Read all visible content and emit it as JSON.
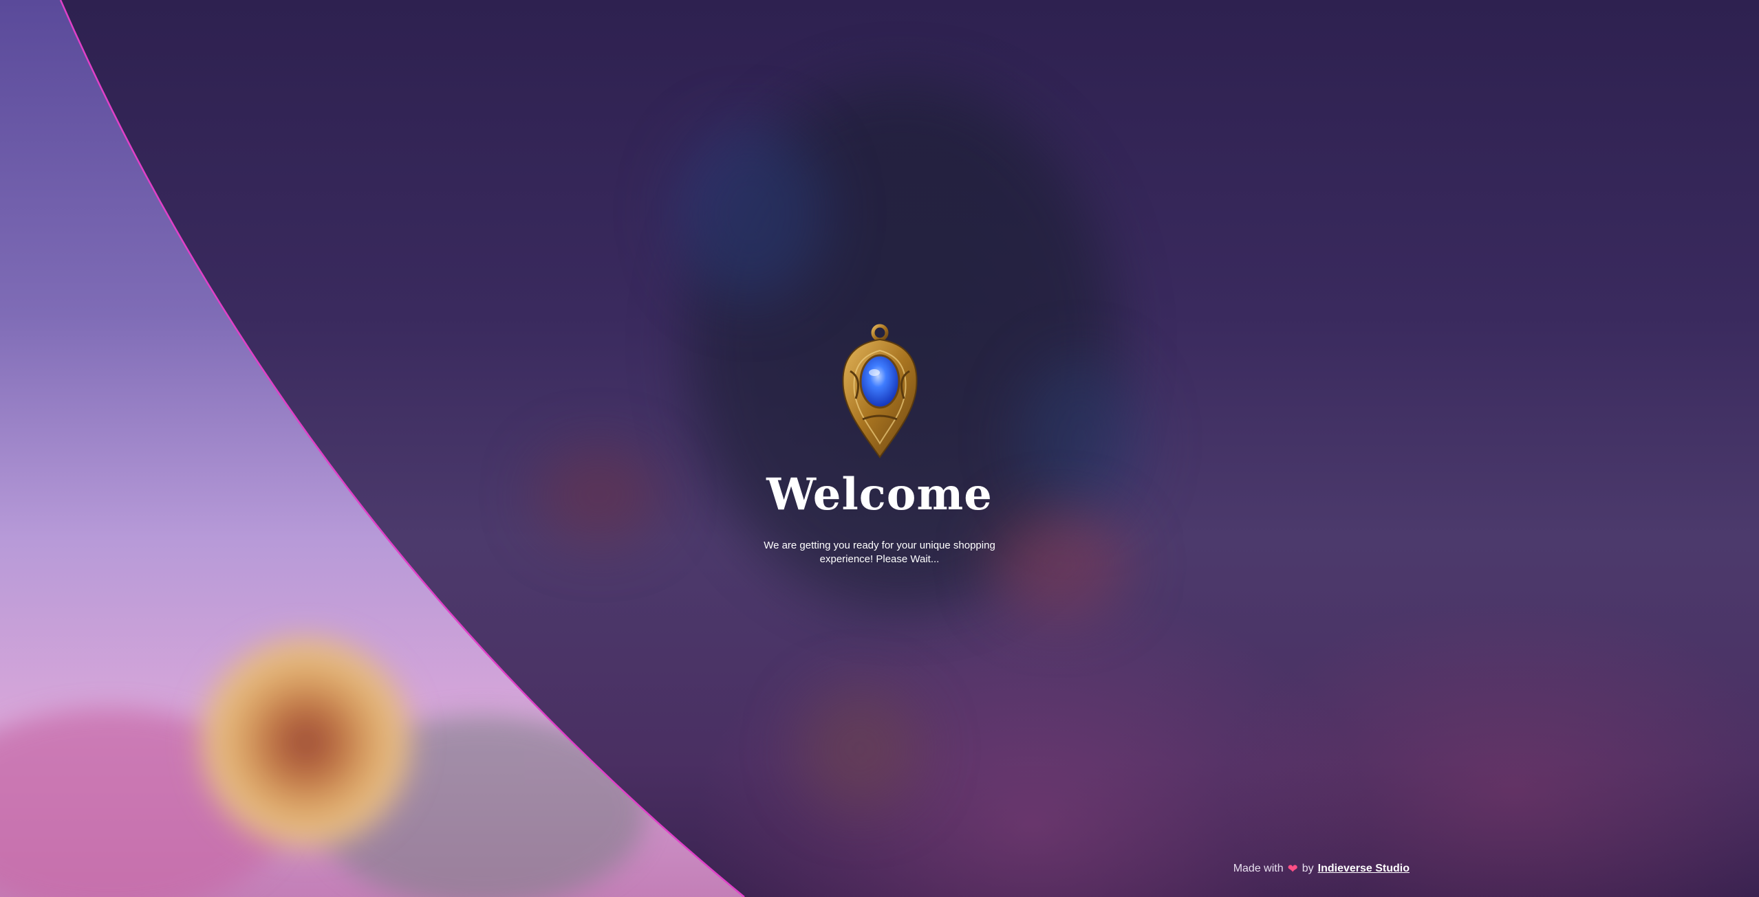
{
  "welcome": {
    "title": "Welcome",
    "message": "We are getting you ready for your unique shopping experience! Please Wait..."
  },
  "footer": {
    "made_with": "Made with",
    "heart_icon": "heart-icon",
    "by": "by",
    "studio_name": "Indieverse Studio"
  },
  "colors": {
    "accent_curve": "#e040c8",
    "heart": "#ff4f86",
    "gem": "#2e6bff",
    "gold": "#b8862a"
  }
}
